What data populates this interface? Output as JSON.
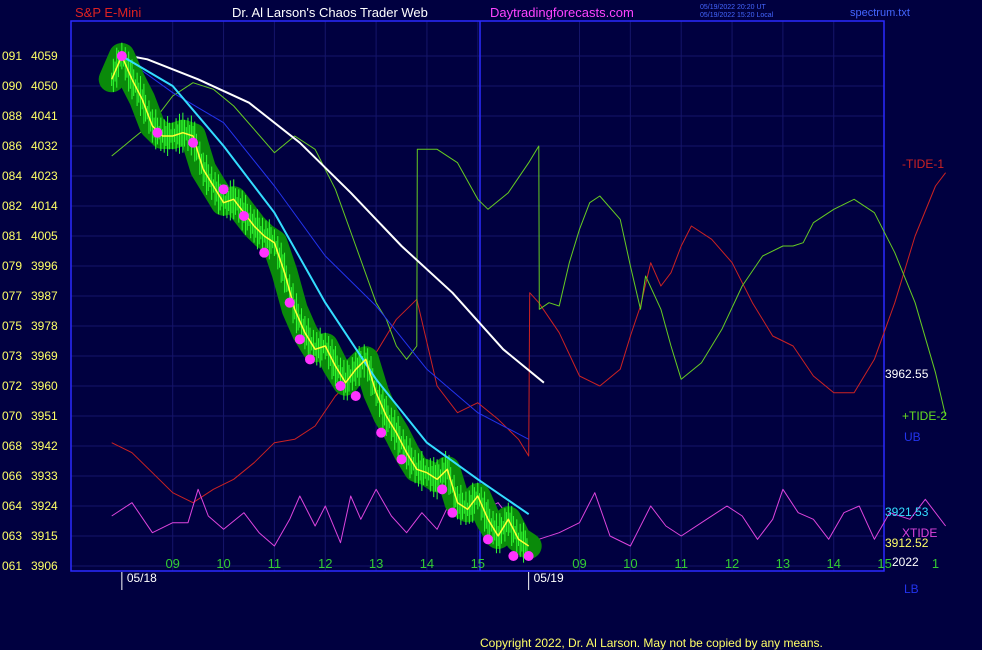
{
  "header": {
    "symbol": "S&P E-Mini",
    "title": "Dr. Al Larson's Chaos Trader Web",
    "site": "Daytradingforecasts.com",
    "stamp_ut": "05/19/2022 20:20 UT",
    "stamp_local": "05/19/2022 15:20 Local",
    "file": "spectrum.txt"
  },
  "footer": {
    "copyright": "Copyright 2022, Dr. Al Larson. May not be copied by any means."
  },
  "colors": {
    "background": "#000040",
    "grid": "#15156a",
    "frame": "#2a2aff",
    "price_band": "#0a8a0a",
    "price_bars": "#33ff33",
    "pivot_dots": "#ff33ff",
    "fast_ma": "#ffff33",
    "cyan_ma": "#33ddff",
    "white_curve": "#ffffff",
    "tide_minus1": "#cc2222",
    "tide_plus2": "#66cc22",
    "xtide": "#dd44dd",
    "blue_curve": "#2233ee"
  },
  "chart_data": {
    "type": "line",
    "title": "S&P E-Mini",
    "ylim": [
      3906,
      4062
    ],
    "y_ticks": [
      {
        "idx": "091",
        "price": "4059"
      },
      {
        "idx": "090",
        "price": "4050"
      },
      {
        "idx": "088",
        "price": "4041"
      },
      {
        "idx": "086",
        "price": "4032"
      },
      {
        "idx": "084",
        "price": "4023"
      },
      {
        "idx": "082",
        "price": "4014"
      },
      {
        "idx": "081",
        "price": "4005"
      },
      {
        "idx": "079",
        "price": "3996"
      },
      {
        "idx": "077",
        "price": "3987"
      },
      {
        "idx": "075",
        "price": "3978"
      },
      {
        "idx": "073",
        "price": "3969"
      },
      {
        "idx": "072",
        "price": "3960"
      },
      {
        "idx": "070",
        "price": "3951"
      },
      {
        "idx": "068",
        "price": "3942"
      },
      {
        "idx": "066",
        "price": "3933"
      },
      {
        "idx": "064",
        "price": "3924"
      },
      {
        "idx": "063",
        "price": "3915"
      },
      {
        "idx": "061",
        "price": "3906"
      }
    ],
    "x_hour_ticks": [
      {
        "label": "09",
        "t": 9.0
      },
      {
        "label": "10",
        "t": 10.0
      },
      {
        "label": "11",
        "t": 11.0
      },
      {
        "label": "12",
        "t": 12.0
      },
      {
        "label": "13",
        "t": 13.0
      },
      {
        "label": "14",
        "t": 14.0
      },
      {
        "label": "15",
        "t": 15.0
      },
      {
        "label": "09",
        "t": 17.0
      },
      {
        "label": "10",
        "t": 18.0
      },
      {
        "label": "11",
        "t": 19.0
      },
      {
        "label": "12",
        "t": 20.0
      },
      {
        "label": "13",
        "t": 21.0
      },
      {
        "label": "14",
        "t": 22.0
      },
      {
        "label": "15",
        "t": 23.0
      },
      {
        "label": "1",
        "t": 24.0
      }
    ],
    "x_date_ticks": [
      {
        "label": "05/18",
        "t": 8.0
      },
      {
        "label": "05/19",
        "t": 16.0
      }
    ],
    "year_label": "2022",
    "series": [
      {
        "name": "price",
        "points": [
          [
            7.8,
            4052
          ],
          [
            8.0,
            4059
          ],
          [
            8.2,
            4052
          ],
          [
            8.4,
            4046
          ],
          [
            8.6,
            4038
          ],
          [
            8.8,
            4035
          ],
          [
            9.0,
            4035
          ],
          [
            9.2,
            4036
          ],
          [
            9.4,
            4035
          ],
          [
            9.6,
            4025
          ],
          [
            9.8,
            4020
          ],
          [
            10.0,
            4015
          ],
          [
            10.2,
            4016
          ],
          [
            10.4,
            4012
          ],
          [
            10.6,
            4008
          ],
          [
            10.8,
            4005
          ],
          [
            11.0,
            4003
          ],
          [
            11.2,
            3994
          ],
          [
            11.4,
            3983
          ],
          [
            11.6,
            3976
          ],
          [
            11.8,
            3971
          ],
          [
            12.0,
            3972
          ],
          [
            12.2,
            3966
          ],
          [
            12.4,
            3961
          ],
          [
            12.6,
            3965
          ],
          [
            12.8,
            3968
          ],
          [
            13.0,
            3958
          ],
          [
            13.2,
            3951
          ],
          [
            13.4,
            3946
          ],
          [
            13.6,
            3940
          ],
          [
            13.8,
            3935
          ],
          [
            14.0,
            3934
          ],
          [
            14.2,
            3932
          ],
          [
            14.4,
            3935
          ],
          [
            14.6,
            3925
          ],
          [
            14.8,
            3923
          ],
          [
            15.0,
            3927
          ],
          [
            15.2,
            3920
          ],
          [
            15.4,
            3915
          ],
          [
            15.6,
            3920
          ],
          [
            15.8,
            3914
          ],
          [
            16.0,
            3912
          ]
        ]
      },
      {
        "name": "pivots",
        "points": [
          [
            8.0,
            4059
          ],
          [
            8.7,
            4036
          ],
          [
            9.4,
            4033
          ],
          [
            10.0,
            4019
          ],
          [
            10.4,
            4011
          ],
          [
            10.8,
            4000
          ],
          [
            11.3,
            3985
          ],
          [
            11.5,
            3974
          ],
          [
            11.7,
            3968
          ],
          [
            12.3,
            3960
          ],
          [
            12.6,
            3957
          ],
          [
            13.1,
            3946
          ],
          [
            13.5,
            3938
          ],
          [
            14.3,
            3929
          ],
          [
            14.5,
            3922
          ],
          [
            15.2,
            3914
          ],
          [
            15.7,
            3909
          ],
          [
            16.0,
            3909
          ]
        ]
      },
      {
        "name": "cyan-ma",
        "label": "3921.53",
        "points": [
          [
            8.0,
            4059
          ],
          [
            9.0,
            4050
          ],
          [
            10.0,
            4032
          ],
          [
            11.0,
            4012
          ],
          [
            12.0,
            3985
          ],
          [
            13.0,
            3962
          ],
          [
            14.0,
            3943
          ],
          [
            15.0,
            3932
          ],
          [
            16.0,
            3921.53
          ]
        ]
      },
      {
        "name": "white-curve",
        "label": "3962.55",
        "points": [
          [
            7.8,
            4060
          ],
          [
            8.5,
            4058
          ],
          [
            9.5,
            4052
          ],
          [
            10.5,
            4045
          ],
          [
            11.5,
            4033
          ],
          [
            12.5,
            4018
          ],
          [
            13.5,
            4002
          ],
          [
            14.5,
            3988
          ],
          [
            15.5,
            3971
          ],
          [
            16.3,
            3961
          ]
        ]
      },
      {
        "name": "ub",
        "label": "UB",
        "points": [
          [
            8.0,
            4059
          ],
          [
            9.0,
            4048
          ],
          [
            10.0,
            4039
          ],
          [
            11.0,
            4020
          ],
          [
            12.0,
            3999
          ],
          [
            13.0,
            3984
          ],
          [
            14.0,
            3965
          ],
          [
            15.0,
            3952
          ],
          [
            16.0,
            3944
          ]
        ]
      },
      {
        "name": "tide-minus-1",
        "label": "-TIDE-1",
        "points": [
          [
            7.8,
            3943
          ],
          [
            8.2,
            3940
          ],
          [
            8.6,
            3934
          ],
          [
            9.0,
            3928
          ],
          [
            9.4,
            3925
          ],
          [
            9.8,
            3929
          ],
          [
            10.2,
            3932
          ],
          [
            10.6,
            3937
          ],
          [
            11.0,
            3943
          ],
          [
            11.4,
            3944
          ],
          [
            11.8,
            3948
          ],
          [
            12.2,
            3957
          ],
          [
            12.6,
            3963
          ],
          [
            13.0,
            3970
          ],
          [
            13.4,
            3980
          ],
          [
            13.8,
            3986
          ],
          [
            14.2,
            3960
          ],
          [
            14.6,
            3952
          ],
          [
            15.0,
            3955
          ],
          [
            15.4,
            3950
          ],
          [
            15.8,
            3944
          ],
          [
            16.0,
            3939
          ],
          [
            16.02,
            3988
          ],
          [
            16.2,
            3985
          ],
          [
            16.6,
            3976
          ],
          [
            17.0,
            3963
          ],
          [
            17.4,
            3960
          ],
          [
            17.8,
            3965
          ],
          [
            18.0,
            3975
          ],
          [
            18.2,
            3984
          ],
          [
            18.4,
            3997
          ],
          [
            18.6,
            3990
          ],
          [
            18.8,
            3994
          ],
          [
            19.0,
            4002
          ],
          [
            19.2,
            4008
          ],
          [
            19.6,
            4004
          ],
          [
            20.0,
            3997
          ],
          [
            20.4,
            3985
          ],
          [
            20.8,
            3975
          ],
          [
            21.2,
            3972
          ],
          [
            21.6,
            3963
          ],
          [
            22.0,
            3958
          ],
          [
            22.4,
            3958
          ],
          [
            22.8,
            3968
          ],
          [
            23.2,
            3985
          ],
          [
            23.6,
            4005
          ],
          [
            24.0,
            4020
          ],
          [
            24.2,
            4024
          ]
        ]
      },
      {
        "name": "tide-plus-2",
        "label": "+TIDE-2",
        "points": [
          [
            7.8,
            4029
          ],
          [
            8.2,
            4034
          ],
          [
            8.6,
            4039
          ],
          [
            9.0,
            4047
          ],
          [
            9.4,
            4051
          ],
          [
            9.8,
            4049
          ],
          [
            10.2,
            4044
          ],
          [
            10.6,
            4037
          ],
          [
            11.0,
            4030
          ],
          [
            11.4,
            4035
          ],
          [
            11.8,
            4031
          ],
          [
            12.2,
            4019
          ],
          [
            12.6,
            4002
          ],
          [
            13.0,
            3985
          ],
          [
            13.2,
            3980
          ],
          [
            13.4,
            3972
          ],
          [
            13.6,
            3968
          ],
          [
            13.8,
            3972
          ],
          [
            13.81,
            4031
          ],
          [
            14.2,
            4031
          ],
          [
            14.6,
            4027
          ],
          [
            15.0,
            4016
          ],
          [
            15.2,
            4013
          ],
          [
            15.6,
            4018
          ],
          [
            16.0,
            4027
          ],
          [
            16.2,
            4032
          ],
          [
            16.21,
            3983
          ],
          [
            16.4,
            3985
          ],
          [
            16.6,
            3984
          ],
          [
            16.8,
            3997
          ],
          [
            17.0,
            4007
          ],
          [
            17.2,
            4015
          ],
          [
            17.4,
            4017
          ],
          [
            17.8,
            4010
          ],
          [
            18.0,
            3996
          ],
          [
            18.2,
            3983
          ],
          [
            18.3,
            3993
          ],
          [
            18.6,
            3983
          ],
          [
            18.8,
            3972
          ],
          [
            19.0,
            3962
          ],
          [
            19.4,
            3967
          ],
          [
            19.8,
            3977
          ],
          [
            20.2,
            3990
          ],
          [
            20.6,
            3999
          ],
          [
            21.0,
            4002
          ],
          [
            21.2,
            4002
          ],
          [
            21.4,
            4003
          ],
          [
            21.6,
            4009
          ],
          [
            22.0,
            4013
          ],
          [
            22.4,
            4016
          ],
          [
            22.8,
            4012
          ],
          [
            23.2,
            4000
          ],
          [
            23.6,
            3985
          ],
          [
            24.0,
            3964
          ],
          [
            24.2,
            3951
          ]
        ]
      },
      {
        "name": "xtide",
        "label": "XTIDE",
        "points": [
          [
            7.8,
            3921
          ],
          [
            8.2,
            3925
          ],
          [
            8.6,
            3916
          ],
          [
            9.0,
            3919
          ],
          [
            9.3,
            3919
          ],
          [
            9.5,
            3929
          ],
          [
            9.7,
            3921
          ],
          [
            10.0,
            3917
          ],
          [
            10.4,
            3922
          ],
          [
            10.7,
            3916
          ],
          [
            11.0,
            3912
          ],
          [
            11.3,
            3920
          ],
          [
            11.5,
            3927
          ],
          [
            11.8,
            3918
          ],
          [
            12.0,
            3924
          ],
          [
            12.3,
            3913
          ],
          [
            12.5,
            3927
          ],
          [
            12.7,
            3920
          ],
          [
            13.0,
            3929
          ],
          [
            13.3,
            3921
          ],
          [
            13.6,
            3916
          ],
          [
            13.9,
            3922
          ],
          [
            14.2,
            3917
          ],
          [
            14.6,
            3930
          ],
          [
            15.0,
            3922
          ],
          [
            15.4,
            3925
          ],
          [
            15.8,
            3917
          ],
          [
            16.2,
            3914
          ],
          [
            16.6,
            3916
          ],
          [
            17.0,
            3919
          ],
          [
            17.3,
            3928
          ],
          [
            17.6,
            3915
          ],
          [
            18.0,
            3912
          ],
          [
            18.4,
            3924
          ],
          [
            18.7,
            3918
          ],
          [
            19.0,
            3915
          ],
          [
            19.5,
            3920
          ],
          [
            19.9,
            3924
          ],
          [
            20.2,
            3921
          ],
          [
            20.5,
            3914
          ],
          [
            20.8,
            3920
          ],
          [
            21.0,
            3929
          ],
          [
            21.3,
            3922
          ],
          [
            21.6,
            3920
          ],
          [
            21.9,
            3914
          ],
          [
            22.2,
            3922
          ],
          [
            22.5,
            3924
          ],
          [
            22.8,
            3914
          ],
          [
            23.1,
            3922
          ],
          [
            23.5,
            3920
          ],
          [
            23.8,
            3926
          ],
          [
            24.2,
            3918
          ]
        ]
      },
      {
        "name": "lb",
        "label": "LB"
      }
    ],
    "right_labels": {
      "tide1": "-TIDE-1",
      "tide2": "+TIDE-2",
      "ub": "UB",
      "lb": "LB",
      "xtide": "XTIDE",
      "v1": "3962.55",
      "v2": "3921.53",
      "v3": "3912.52"
    }
  }
}
